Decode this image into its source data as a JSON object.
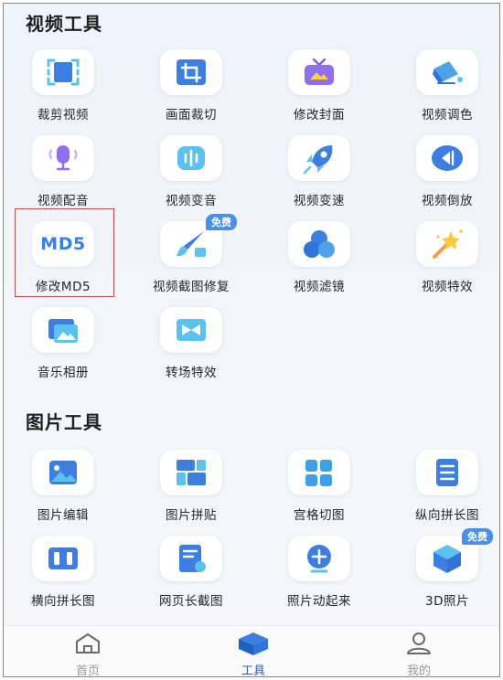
{
  "sections": [
    {
      "title": "视频工具",
      "tools": [
        {
          "label": "裁剪视频",
          "icon": "crop-video-icon"
        },
        {
          "label": "画面裁切",
          "icon": "frame-crop-icon"
        },
        {
          "label": "修改封面",
          "icon": "cover-tv-icon"
        },
        {
          "label": "视频调色",
          "icon": "paint-bucket-icon"
        },
        {
          "label": "视频配音",
          "icon": "microphone-icon"
        },
        {
          "label": "视频变音",
          "icon": "voice-wave-icon"
        },
        {
          "label": "视频变速",
          "icon": "rocket-icon"
        },
        {
          "label": "视频倒放",
          "icon": "rewind-icon"
        },
        {
          "label": "修改MD5",
          "icon": "md5-text-icon",
          "icon_text": "MD5"
        },
        {
          "label": "视频截图修复",
          "icon": "brush-repair-icon",
          "badge": "免费"
        },
        {
          "label": "视频滤镜",
          "icon": "filter-circles-icon"
        },
        {
          "label": "视频特效",
          "icon": "magic-wand-icon"
        },
        {
          "label": "音乐相册",
          "icon": "photo-album-icon"
        },
        {
          "label": "转场特效",
          "icon": "transition-icon"
        }
      ]
    },
    {
      "title": "图片工具",
      "tools": [
        {
          "label": "图片编辑",
          "icon": "image-edit-icon"
        },
        {
          "label": "图片拼贴",
          "icon": "collage-icon"
        },
        {
          "label": "宫格切图",
          "icon": "grid-cut-icon"
        },
        {
          "label": "纵向拼长图",
          "icon": "vertical-stitch-icon"
        },
        {
          "label": "横向拼长图",
          "icon": "horizontal-stitch-icon"
        },
        {
          "label": "网页长截图",
          "icon": "web-screenshot-icon"
        },
        {
          "label": "照片动起来",
          "icon": "animate-photo-icon"
        },
        {
          "label": "3D照片",
          "icon": "cube-3d-icon",
          "badge": "免费"
        }
      ]
    }
  ],
  "tabs": [
    {
      "label": "首页",
      "icon": "home-icon",
      "active": false
    },
    {
      "label": "工具",
      "icon": "toolbox-cube-icon",
      "active": true
    },
    {
      "label": "我的",
      "icon": "user-icon",
      "active": false
    }
  ],
  "colors": {
    "accent": "#1f5fbf",
    "icon_blue": "#3d7fe0",
    "icon_light": "#5bc2ef",
    "icon_purple": "#7b5fe0",
    "badge": "#4a90e8",
    "highlight_border": "#c94a4a"
  }
}
